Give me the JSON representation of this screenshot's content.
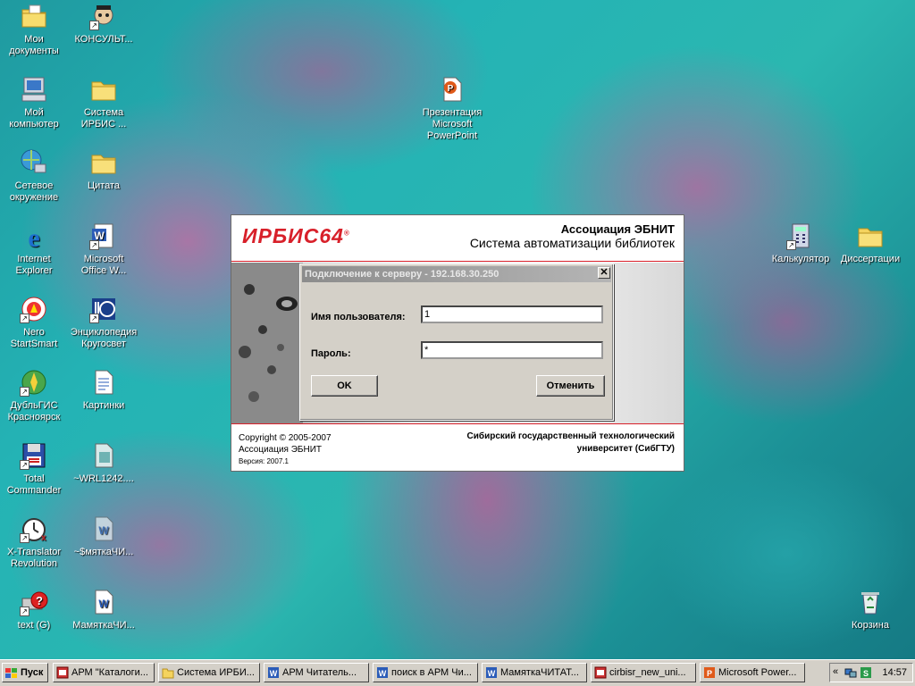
{
  "desktop_icons": [
    {
      "id": "my-documents",
      "label": "Мои документы",
      "icon": "folder-docs-icon",
      "shortcut": false
    },
    {
      "id": "konsult",
      "label": "КОНСУЛЬТ...",
      "icon": "consultant-icon",
      "shortcut": true
    },
    {
      "id": "my-computer",
      "label": "Мой компьютер",
      "icon": "computer-icon",
      "shortcut": false
    },
    {
      "id": "irbis-folder",
      "label": "Система ИРБИС ...",
      "icon": "folder-icon",
      "shortcut": false
    },
    {
      "id": "network",
      "label": "Сетевое окружение",
      "icon": "network-icon",
      "shortcut": false
    },
    {
      "id": "citata",
      "label": "Цитата",
      "icon": "folder-icon",
      "shortcut": false
    },
    {
      "id": "ie",
      "label": "Internet Explorer",
      "icon": "ie-icon",
      "shortcut": false
    },
    {
      "id": "office-word",
      "label": "Microsoft Office W...",
      "icon": "word-icon",
      "shortcut": true
    },
    {
      "id": "nero",
      "label": "Nero StartSmart",
      "icon": "nero-icon",
      "shortcut": true
    },
    {
      "id": "krugosvet",
      "label": "Энциклопедия Кругосвет",
      "icon": "encyclopedia-icon",
      "shortcut": true
    },
    {
      "id": "dubgis",
      "label": "ДубльГИС Красноярск",
      "icon": "globe-icon",
      "shortcut": true
    },
    {
      "id": "kartinki",
      "label": "Картинки",
      "icon": "document-icon",
      "shortcut": false
    },
    {
      "id": "total-commander",
      "label": "Total Commander",
      "icon": "floppy-icon",
      "shortcut": true
    },
    {
      "id": "wrl",
      "label": "~WRL1242....",
      "icon": "tmp-file-icon",
      "shortcut": false
    },
    {
      "id": "xtranslator",
      "label": "X-Translator Revolution",
      "icon": "translator-icon",
      "shortcut": true
    },
    {
      "id": "pamyatka-tmp",
      "label": "~$мяткаЧИ...",
      "icon": "word-doc-faded-icon",
      "shortcut": false
    },
    {
      "id": "text-g",
      "label": "text (G)",
      "icon": "help-drive-icon",
      "shortcut": true
    },
    {
      "id": "pamyatka",
      "label": "МамяткаЧИ...",
      "icon": "word-doc-icon",
      "shortcut": false
    },
    {
      "id": "presentation",
      "label": "Презентация Microsoft PowerPoint",
      "icon": "powerpoint-icon",
      "shortcut": false
    },
    {
      "id": "calculator",
      "label": "Калькулятор",
      "icon": "calculator-icon",
      "shortcut": true
    },
    {
      "id": "dissertations",
      "label": "Диссертации",
      "icon": "folder-icon",
      "shortcut": false
    },
    {
      "id": "recycle-bin",
      "label": "Корзина",
      "icon": "recycle-bin-icon",
      "shortcut": false
    }
  ],
  "splash": {
    "logo": "ИРБИС64",
    "logo_mark": "®",
    "org_line1": "Ассоциация ЭБНИТ",
    "org_line2": "Система автоматизации библиотек",
    "copyright": "Copyright © 2005-2007",
    "association": "Ассоциация ЭБНИТ",
    "version": "Версия: 2007.1",
    "university_line1": "Сибирский государственный технологический",
    "university_line2": "университет (СибГТУ)"
  },
  "login": {
    "title": "Подключение к серверу - 192.168.30.250",
    "close_glyph": "✕",
    "username_label": "Имя пользователя:",
    "username_value": "1",
    "password_label": "Пароль:",
    "password_value": "*",
    "ok_label": "OK",
    "cancel_label": "Отменить"
  },
  "taskbar": {
    "start_label": "Пуск",
    "tasks": [
      {
        "label": "АРМ \"Каталоги...",
        "icon": "app-icon"
      },
      {
        "label": "Система ИРБИ...",
        "icon": "folder-icon"
      },
      {
        "label": "АРМ Читатель...",
        "icon": "word-icon"
      },
      {
        "label": "поиск в АРМ Чи...",
        "icon": "word-icon"
      },
      {
        "label": "МамяткаЧИТАТ...",
        "icon": "word-icon"
      },
      {
        "label": "cirbisr_new_uni...",
        "icon": "app-icon"
      },
      {
        "label": "Microsoft Power...",
        "icon": "powerpoint-icon"
      }
    ],
    "tray_chevron": "«",
    "clock": "14:57"
  },
  "colors": {
    "irbis_red": "#d8202a",
    "desktop_teal": "#24b3b5",
    "dialog_gray": "#d4d0c8"
  }
}
